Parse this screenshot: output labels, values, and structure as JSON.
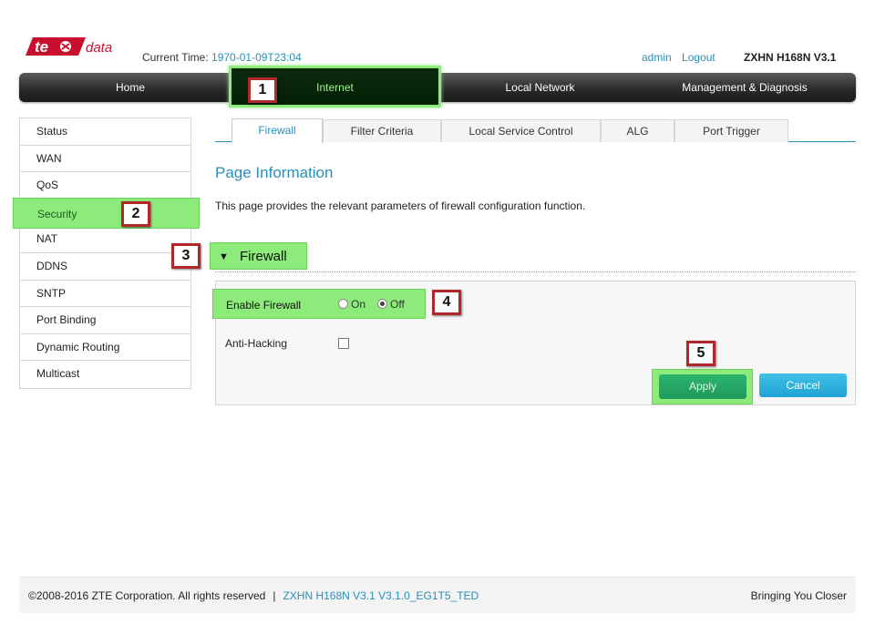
{
  "header": {
    "logo_text": "te data",
    "current_time_label": "Current Time:",
    "current_time_value": "1970-01-09T23:04",
    "user": "admin",
    "logout": "Logout",
    "model": "ZXHN H168N V3.1"
  },
  "nav": {
    "items": [
      "Home",
      "Internet",
      "Local Network",
      "Management & Diagnosis"
    ],
    "active": "Internet"
  },
  "sidebar": {
    "items": [
      "Status",
      "WAN",
      "QoS",
      "Security",
      "NAT",
      "DDNS",
      "SNTP",
      "Port Binding",
      "Dynamic Routing",
      "Multicast"
    ],
    "active": "Security"
  },
  "tabs": {
    "items": [
      "Firewall",
      "Filter Criteria",
      "Local Service Control",
      "ALG",
      "Port Trigger"
    ],
    "active": "Firewall"
  },
  "page": {
    "title": "Page Information",
    "description": "This page provides the relevant parameters of firewall configuration function."
  },
  "firewall": {
    "section_title": "Firewall",
    "enable_label": "Enable Firewall",
    "on_label": "On",
    "off_label": "Off",
    "selected": "Off",
    "anti_hacking_label": "Anti-Hacking",
    "anti_hacking_checked": false,
    "apply_label": "Apply",
    "cancel_label": "Cancel"
  },
  "callouts": [
    "1",
    "2",
    "3",
    "4",
    "5"
  ],
  "footer": {
    "copyright": "©2008-2016 ZTE Corporation. All rights reserved",
    "separator": "|",
    "version": "ZXHN H168N V3.1 V3.1.0_EG1T5_TED",
    "tagline": "Bringing You Closer"
  },
  "colors": {
    "accent": "#2a8fb8",
    "highlight": "#8deb7b",
    "apply": "#1e9a5a",
    "cancel": "#1fa3d3",
    "callout_border": "#b3262a"
  }
}
